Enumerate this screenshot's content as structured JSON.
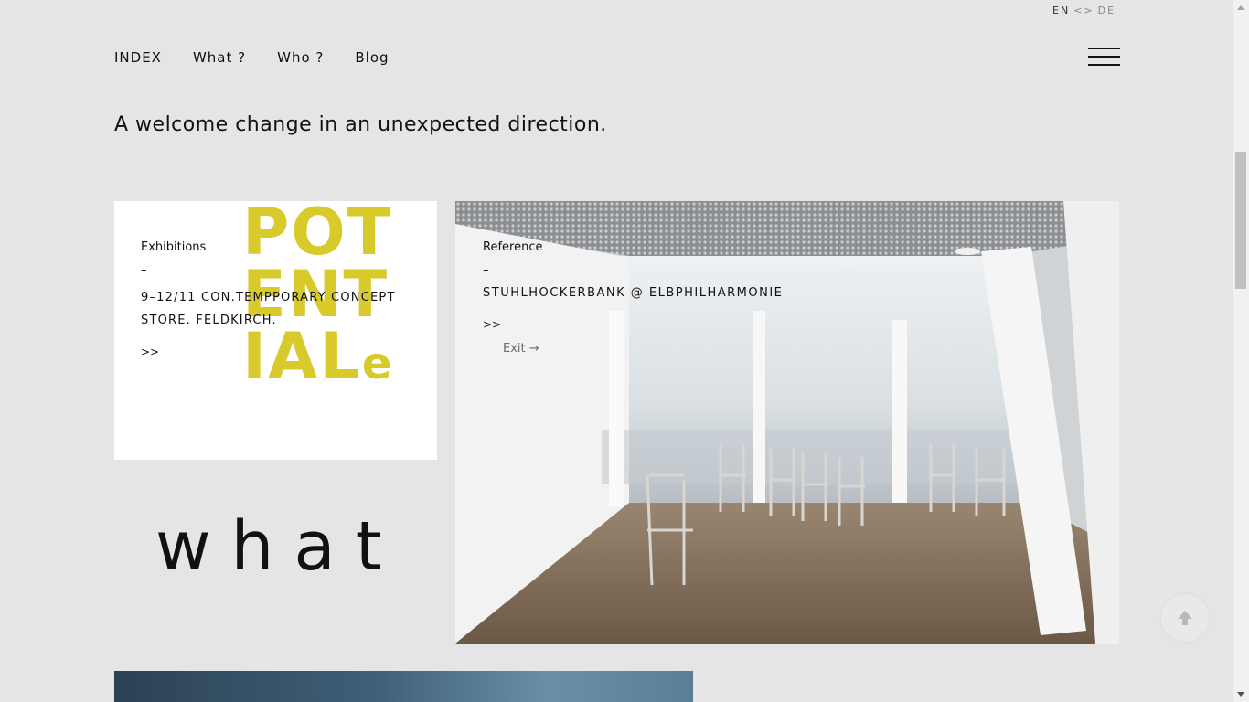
{
  "lang": {
    "en": "EN",
    "sep": "<>",
    "de": "DE"
  },
  "nav": {
    "items": [
      {
        "label": "INDEX"
      },
      {
        "label": "What ?"
      },
      {
        "label": "Who ?"
      },
      {
        "label": "Blog"
      }
    ]
  },
  "tagline": "A welcome change in an unexpected direction.",
  "exhibition_card": {
    "image_text": [
      "POT",
      "ENT",
      "IAL",
      "e"
    ],
    "category": "Exhibitions",
    "dash": "–",
    "title": "9–12/11 CON.TEMPPORARY CONCEPT STORE. FELDKIRCH.",
    "more": ">>"
  },
  "what_word": "what",
  "reference_card": {
    "category": "Reference",
    "dash": "–",
    "title": "STUHLHOCKERBANK @ ELBPHILHARMONIE",
    "more": ">>",
    "exit_sign": "Exit →"
  },
  "colors": {
    "background": "#e5e5e5",
    "potentiale_yellow": "#d7ca2a"
  },
  "icons": {
    "menu": "hamburger-icon",
    "back_to_top": "arrow-up-icon"
  }
}
